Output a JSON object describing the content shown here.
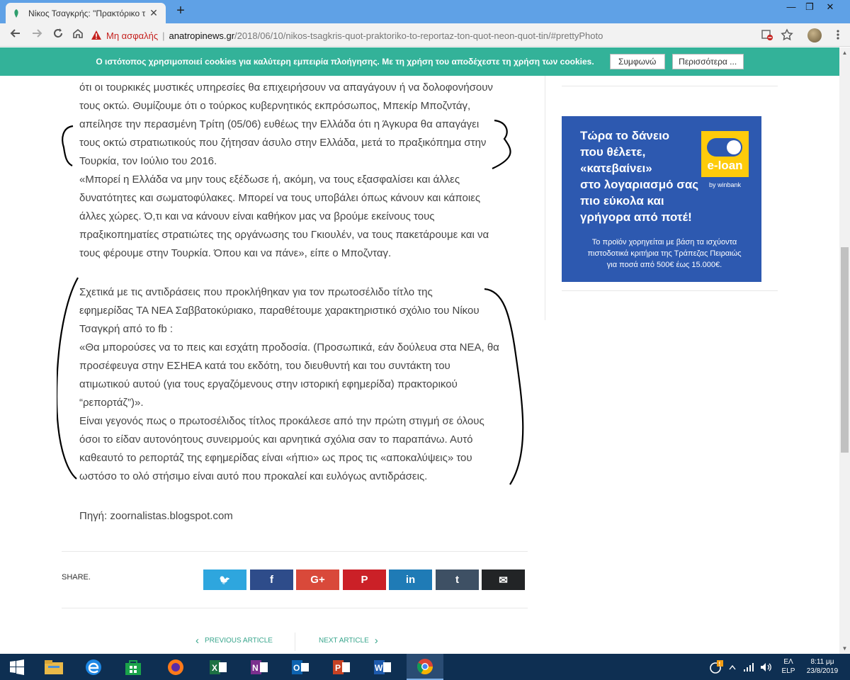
{
  "browser": {
    "tab_title": "Νίκος Τσαγκρής: \"Πρακτόρικο τ",
    "tab_close": "✕",
    "new_tab": "+",
    "window_controls": {
      "minimize": "—",
      "restore": "❐",
      "close": "✕"
    },
    "security_label": "Μη ασφαλής",
    "separator": "|",
    "url_domain": "anatropinews.gr",
    "url_path": "/2018/06/10/nikos-tsagkris-quot-praktoriko-to-reportaz-ton-quot-neon-quot-tin/#prettyPhoto",
    "nav_icons": [
      "back-icon",
      "forward-icon",
      "reload-icon",
      "home-icon"
    ]
  },
  "cookie_bar": {
    "message": "Ο ιστότοπος χρησιμοποιεί cookies για καλύτερη εμπειρία πλοήγησης. Με τη χρήση του αποδέχεστε τη χρήση των cookies.",
    "accept_label": "Συμφωνώ",
    "more_label": "Περισσότερα ...",
    "color": "#33b299"
  },
  "article": {
    "lines_block1": [
      "ότι οι τουρκικές μυστικές υπηρεσίες θα επιχειρήσουν να απαγάγουν ή να δολοφονήσουν",
      "τους οκτώ. Θυμίζουμε ότι ο τούρκος κυβερνητικός εκπρόσωπος, Μπεκίρ Μποζντάγ,",
      "απείλησε την περασμένη Τρίτη (05/06) ευθέως την Ελλάδα ότι η Άγκυρα θα απαγάγει",
      "τους οκτώ στρατιωτικούς που ζήτησαν άσυλο στην Ελλάδα, μετά το πραξικόπημα στην",
      "Τουρκία, τον Ιούλιο του 2016.",
      "«Μπορεί η Ελλάδα να μην τους εξέδωσε ή, ακόμη, να τους εξασφαλίσει και άλλες",
      "δυνατότητες και σωματοφύλακες. Μπορεί να τους υποβάλει όπως κάνουν και κάποιες",
      "άλλες χώρες. Ό,τι και να κάνουν είναι καθήκον μας να βρούμε εκείνους τους",
      "πραξικοπηματίες στρατιώτες της οργάνωσης του Γκιουλέν, να τους πακετάρουμε και να",
      "τους φέρουμε στην Τουρκία. Όπου και να πάνε», είπε ο Μποζνταγ."
    ],
    "lines_block2": [
      "Σχετικά με τις αντιδράσεις που προκλήθηκαν για τον πρωτοσέλιδο τίτλο της",
      "εφημερίδας ΤΑ ΝΕΑ Σαββατοκύριακο, παραθέτουμε χαρακτηριστικό σχόλιο του Νίκου",
      "Τσαγκρή από το fb :",
      "«Θα μπορούσες να το πεις και εσχάτη προδοσία. (Προσωπικά, εάν δούλευα στα ΝΕΑ, θα",
      "προσέφευγα στην ΕΣΗΕΑ κατά του εκδότη, του διευθυντή και του συντάκτη του",
      "ατιμωτικού αυτού (για τους εργαζόμενους στην ιστορική εφημερίδα) πρακτορικού",
      "“ρεπορτάζ”)».",
      "Είναι γεγονός πως ο πρωτοσέλιδος τίτλος προκάλεσε από την πρώτη στιγμή σε όλους",
      "όσοι το είδαν αυτονόητους συνειρμούς και αρνητικά σχόλια σαν το παραπάνω. Αυτό",
      "καθεαυτό το ρεπορτάζ της εφημερίδας είναι «ήπιο» ως προς τις «αποκαλύψεις» του",
      "ωστόσο το ολό στήσιμο είναι αυτό που προκαλεί και ευλόγως αντιδράσεις."
    ],
    "source": "Πηγή: zoornalistas.blogspot.com"
  },
  "ad": {
    "headline": [
      "Τώρα το δάνειο",
      "που θέλετε,",
      "«κατεβαίνει»",
      "στο λογαριασμό σας",
      "πιο εύκολα και",
      "γρήγορα από ποτέ!"
    ],
    "logo_text": "e-loan",
    "logo_sub": "by winbank",
    "small_print": [
      "Το προϊόν χορηγείται με βάση τα ισχύοντα",
      "πιστοδοτικά κριτήρια της Τράπεζας Πειραιώς",
      "για ποσά από 500€ έως 15.000€."
    ],
    "background": "#2d59b0",
    "logo_color": "#fecb0b"
  },
  "share": {
    "label": "SHARE.",
    "buttons": [
      {
        "name": "twitter",
        "glyph": "🐦",
        "color": "#2ea6de"
      },
      {
        "name": "facebook",
        "glyph": "f",
        "color": "#2e4c8a"
      },
      {
        "name": "google-plus",
        "glyph": "G+",
        "color": "#d9493a"
      },
      {
        "name": "pinterest",
        "glyph": "P",
        "color": "#cb2027"
      },
      {
        "name": "linkedin",
        "glyph": "in",
        "color": "#1f7bb6"
      },
      {
        "name": "tumblr",
        "glyph": "t",
        "color": "#3e5064"
      },
      {
        "name": "email",
        "glyph": "✉",
        "color": "#222426"
      }
    ]
  },
  "article_nav": {
    "prev_label": "PREVIOUS ARTICLE",
    "next_label": "NEXT ARTICLE",
    "prev_arrow": "‹",
    "next_arrow": "›"
  },
  "taskbar": {
    "apps": [
      "start-icon",
      "file-explorer-icon",
      "edge-icon",
      "store-icon",
      "firefox-icon",
      "excel-icon",
      "onenote-icon",
      "outlook-icon",
      "powerpoint-icon",
      "word-icon",
      "chrome-icon"
    ],
    "lang_line1": "ΕΛ",
    "lang_line2": "ELP",
    "time": "8:11 μμ",
    "date": "23/8/2019",
    "bar_color": "#0e2f52"
  }
}
